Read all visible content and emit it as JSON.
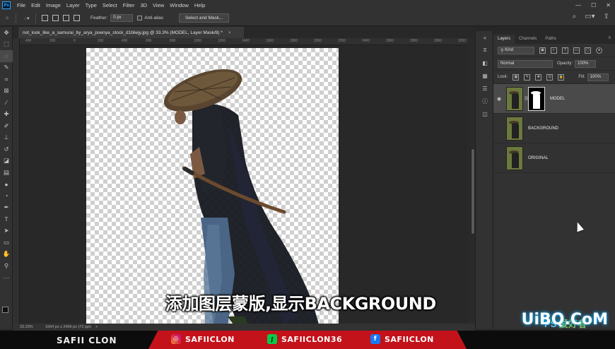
{
  "menubar": {
    "app_logo": "Ps",
    "items": [
      "File",
      "Edit",
      "Image",
      "Layer",
      "Type",
      "Select",
      "Filter",
      "3D",
      "View",
      "Window",
      "Help"
    ]
  },
  "options": {
    "feather_label": "Feather:",
    "feather_value": "0 px",
    "antialias_label": "Anti-alias",
    "select_mask_label": "Select and Mask..."
  },
  "document": {
    "tab_title": "not_look_like_a_samurai_by_arya_poenya_stock_d1bliejy.jpg @ 33.3% (MODEL, Layer Mask/8) *",
    "close": "×"
  },
  "rulers": {
    "h_ticks": [
      "400",
      "200",
      "0",
      "200",
      "400",
      "600",
      "800",
      "1000",
      "1200",
      "1400",
      "1600",
      "1800",
      "2000",
      "2200",
      "2400",
      "2600",
      "2800",
      "3000",
      "3200"
    ]
  },
  "subtitle": "添加图层蒙版,显示BACKGROUND",
  "status": {
    "zoom": "33.33%",
    "dimensions": "1664 px x 2496 px (72 ppi)",
    "arrow": ">"
  },
  "layers_panel": {
    "tabs": [
      "Layers",
      "Channels",
      "Paths"
    ],
    "filter_kind": "Kind",
    "blend_mode": "Normal",
    "opacity_label": "Opacity:",
    "opacity_value": "100%",
    "lock_label": "Lock:",
    "fill_label": "Fill:",
    "fill_value": "100%",
    "layers": [
      {
        "name": "MODEL",
        "visible": true,
        "selected": true,
        "has_mask": true
      },
      {
        "name": "BACKGROUND",
        "visible": false,
        "selected": false,
        "has_mask": false
      },
      {
        "name": "ORIGINAL",
        "visible": false,
        "selected": false,
        "has_mask": false
      }
    ]
  },
  "footer": {
    "channel_name": "SAFII CLON",
    "instagram": "SAFIICLON",
    "deviantart": "SAFIICLON36",
    "facebook": "SAFIICLON"
  },
  "watermark": {
    "brand": "UiBQ.CoM",
    "ps_text": "PS",
    "tagline": "爱好者"
  },
  "colors": {
    "footer_band": "#c4121a",
    "app_bg": "#323232",
    "watermark_glow": "#1a9fe0"
  }
}
